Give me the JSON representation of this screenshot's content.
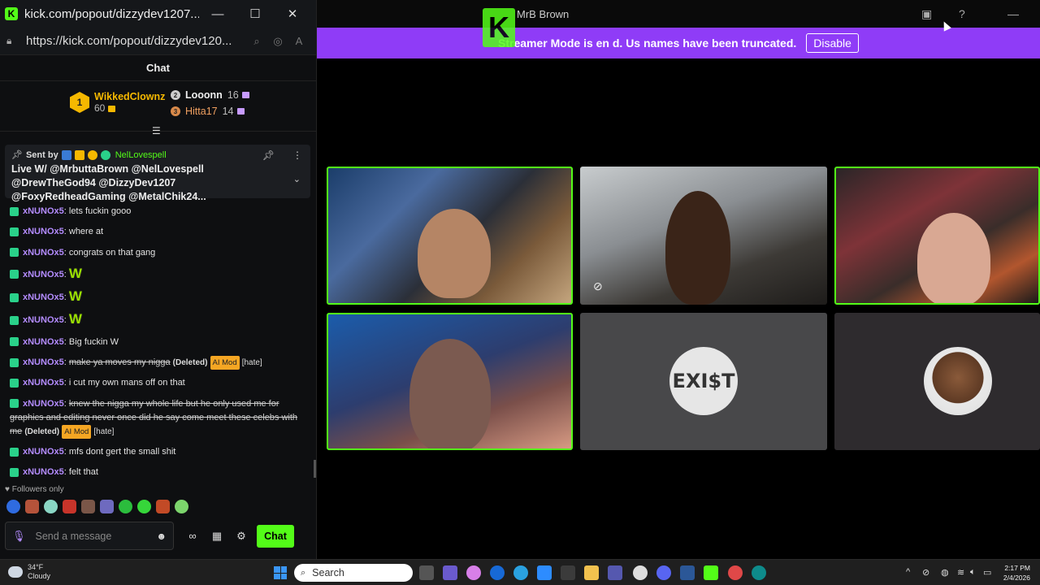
{
  "popout": {
    "title": "kick.com/popout/dizzydev1207...",
    "url": "https://kick.com/popout/dizzydev120...",
    "chat_header": "Chat",
    "leaderboard": {
      "first": {
        "rank": "1",
        "name": "WikkedClownz",
        "count": "60"
      },
      "second": {
        "name": "Looonn",
        "count": "16"
      },
      "third": {
        "name": "Hitta17",
        "count": "14"
      }
    },
    "pinned": {
      "sent_by_label": "Sent by",
      "sender": "NelLovespell",
      "message": "Live W/ @MrbuttaBrown @NelLovespell @DrewTheGod94 @DizzyDev1207 @FoxyRedheadGaming @MetalChik24..."
    },
    "messages": [
      {
        "user": "xNUNOx5",
        "text": "lets fuckin gooo"
      },
      {
        "user": "xNUNOx5",
        "text": "where at"
      },
      {
        "user": "xNUNOx5",
        "text": "congrats on that gang"
      },
      {
        "user": "xNUNOx5",
        "emote": "W"
      },
      {
        "user": "xNUNOx5",
        "emote": "W"
      },
      {
        "user": "xNUNOx5",
        "emote": "W"
      },
      {
        "user": "xNUNOx5",
        "text": "Big fuckin W"
      },
      {
        "user": "xNUNOx5",
        "text": "make ya moves my nigga",
        "deleted": "(Deleted)",
        "mod": "AI Mod",
        "flag": "[hate]"
      },
      {
        "user": "xNUNOx5",
        "text": "i cut my own mans off on that"
      },
      {
        "user": "xNUNOx5",
        "text": "knew the nigga my whole life but he only used me for graphics and editing never once did he say come meet these celebs with me",
        "deleted": "(Deleted)",
        "mod": "AI Mod",
        "flag": "[hate]"
      },
      {
        "user": "xNUNOx5",
        "text": "mfs dont gert the small shit"
      },
      {
        "user": "xNUNOx5",
        "text": "felt that"
      }
    ],
    "followers_only": "Followers only",
    "input_placeholder": "Send a message",
    "chat_button": "Chat"
  },
  "main": {
    "title": "MrB  Brown",
    "streamer_mode_text": "Streamer Mode is en      d. Us  names have been truncated.",
    "disable_button": "Disable",
    "tiles": [
      {
        "name": "tile-1",
        "live": true
      },
      {
        "name": "tile-2",
        "live": false
      },
      {
        "name": "tile-3",
        "live": true
      },
      {
        "name": "tile-4",
        "live": true
      },
      {
        "name": "tile-5",
        "live": false,
        "avatar_text": "EXI$T"
      },
      {
        "name": "tile-6",
        "live": false
      }
    ]
  },
  "taskbar": {
    "weather_temp": "34°F",
    "weather_desc": "Cloudy",
    "search": "Search",
    "time": "2:17 PM",
    "date": "2/4/2026"
  },
  "colors": {
    "kick_green": "#53fc18",
    "streamer_purple": "#8f3cf7",
    "username_purple": "#b48cff",
    "gold": "#f5b800"
  }
}
